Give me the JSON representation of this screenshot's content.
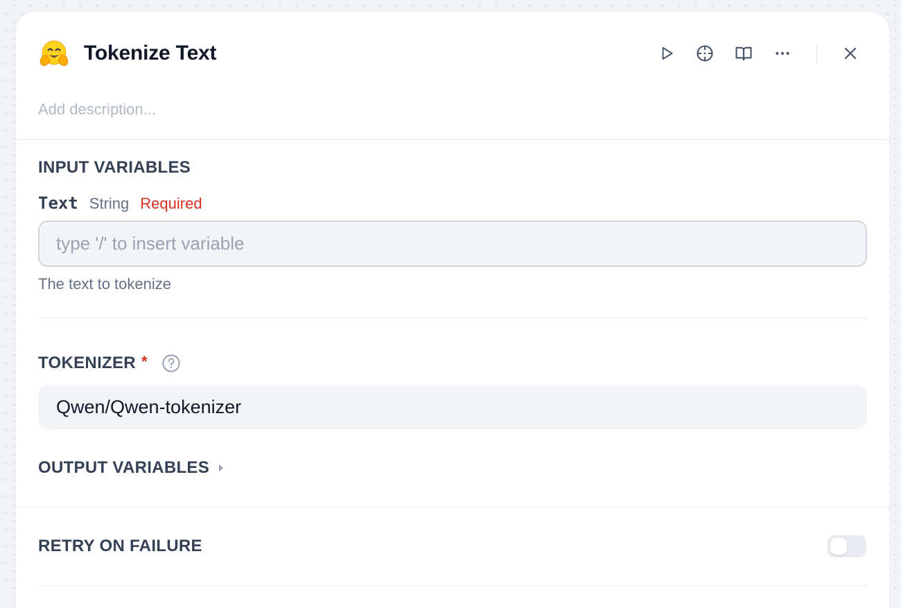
{
  "node": {
    "icon": "hugging-face-emoji-icon",
    "title": "Tokenize Text",
    "description_placeholder": "Add description..."
  },
  "toolbar": {
    "run_icon": "play-icon",
    "locate_icon": "crosshair-icon",
    "docs_icon": "open-book-icon",
    "more_icon": "ellipsis-icon",
    "close_icon": "close-icon"
  },
  "input_variables": {
    "section_title": "INPUT VARIABLES",
    "variables": [
      {
        "name": "Text",
        "type": "String",
        "required_label": "Required",
        "placeholder": "type '/' to insert variable",
        "value": "",
        "helper": "The text to tokenize"
      }
    ]
  },
  "tokenizer": {
    "label": "TOKENIZER",
    "required_mark": "*",
    "help_icon": "question-circle-icon",
    "value": "Qwen/Qwen-tokenizer"
  },
  "output_variables": {
    "label": "OUTPUT VARIABLES",
    "expanded": false,
    "caret_icon": "caret-right-icon"
  },
  "retry": {
    "label": "RETRY ON FAILURE",
    "enabled": false
  },
  "colors": {
    "required": "#d92d20",
    "text_primary": "#101828",
    "text_secondary": "#667085",
    "input_bg": "#f2f4f7"
  }
}
